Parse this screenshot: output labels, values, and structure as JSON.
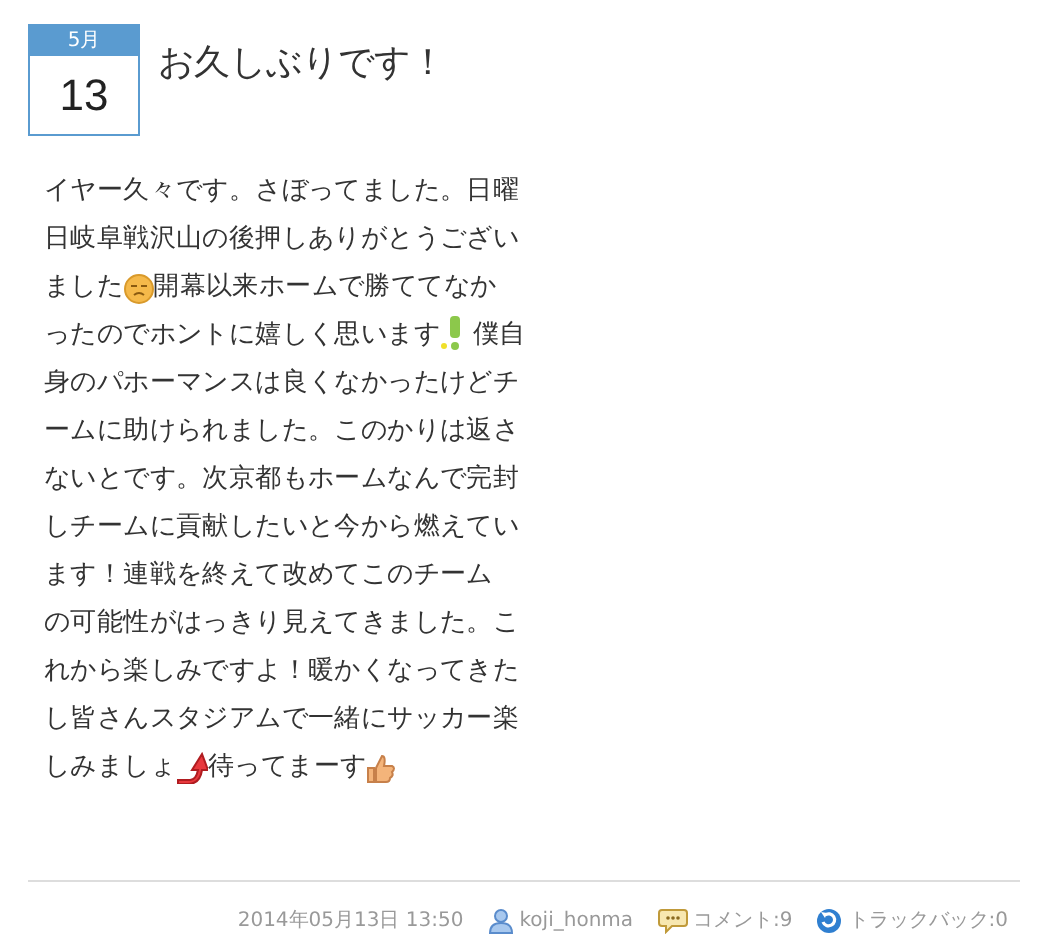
{
  "date_badge": {
    "month": "5月",
    "day": "13"
  },
  "title": "お久しぶりです！",
  "body_lines": [
    [
      {
        "kind": "text",
        "text": "イヤー久々です。さぼってました。日曜"
      }
    ],
    [
      {
        "kind": "text",
        "text": "日岐阜戦沢山の後押しありがとうござい"
      }
    ],
    [
      {
        "kind": "text",
        "text": "ました"
      },
      {
        "kind": "face"
      },
      {
        "kind": "text",
        "text": "開幕以来ホームで勝ててなか"
      }
    ],
    [
      {
        "kind": "text",
        "text": "ったのでホントに嬉しく思います"
      },
      {
        "kind": "exclaim"
      },
      {
        "kind": "text",
        "text": " 僕自"
      }
    ],
    [
      {
        "kind": "text",
        "text": "身のパホーマンスは良くなかったけどチ"
      }
    ],
    [
      {
        "kind": "text",
        "text": "ームに助けられました。このかりは返さ"
      }
    ],
    [
      {
        "kind": "text",
        "text": "ないとです。次京都もホームなんで完封"
      }
    ],
    [
      {
        "kind": "text",
        "text": "しチームに貢献したいと今から燃えてい"
      }
    ],
    [
      {
        "kind": "text",
        "text": "ます！連戦を終えて改めてこのチーム"
      }
    ],
    [
      {
        "kind": "text",
        "text": "の可能性がはっきり見えてきました。こ"
      }
    ],
    [
      {
        "kind": "text",
        "text": "れから楽しみですよ！暖かくなってきた"
      }
    ],
    [
      {
        "kind": "text",
        "text": "し皆さんスタジアムで一緒にサッカー楽"
      }
    ],
    [
      {
        "kind": "text",
        "text": "しみましょ"
      },
      {
        "kind": "arrow"
      },
      {
        "kind": "text",
        "text": "待ってまーす"
      },
      {
        "kind": "thumb"
      }
    ]
  ],
  "footer": {
    "datetime": "2014年05月13日 13:50",
    "author": "koji_honma",
    "comments": "コメント:9",
    "trackbacks": "トラックバック:0"
  }
}
